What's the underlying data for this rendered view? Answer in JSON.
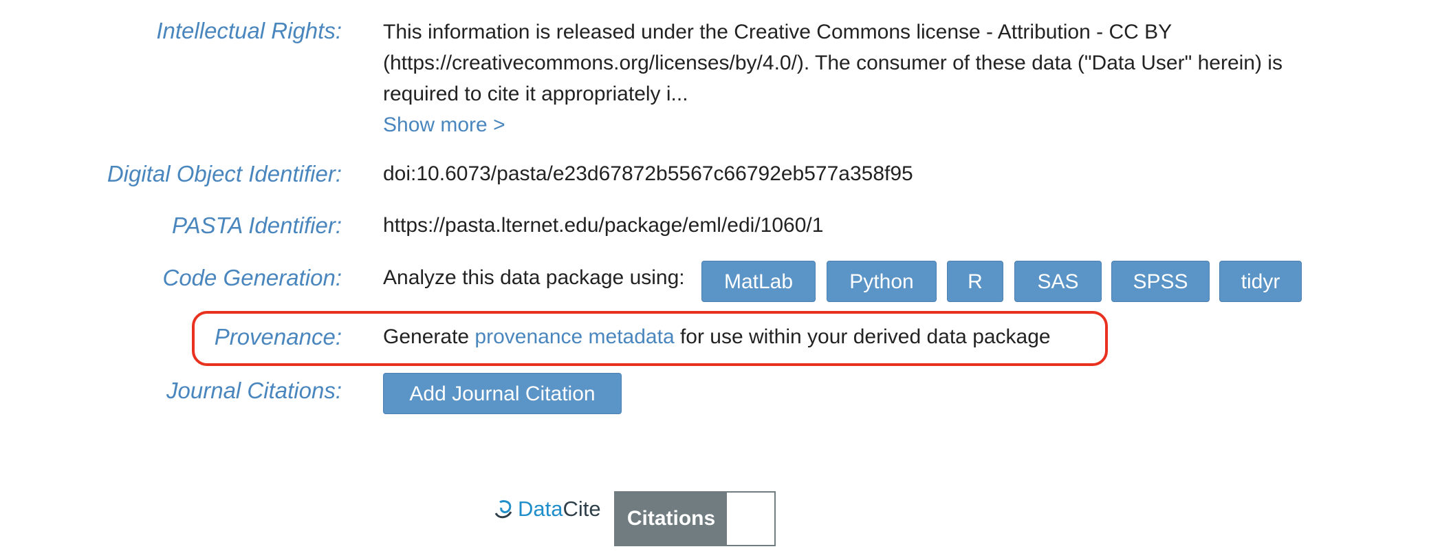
{
  "intellectual_rights": {
    "label": "Intellectual Rights:",
    "text": "This information is released under the Creative Commons license - Attribution - CC BY (https://creativecommons.org/licenses/by/4.0/). The consumer of these data (\"Data User\" herein) is required to cite it appropriately i...",
    "show_more": "Show more >"
  },
  "doi": {
    "label": "Digital Object Identifier:",
    "value": "doi:10.6073/pasta/e23d67872b5567c66792eb577a358f95"
  },
  "pasta": {
    "label": "PASTA Identifier:",
    "value": "https://pasta.lternet.edu/package/eml/edi/1060/1"
  },
  "code_generation": {
    "label": "Code Generation:",
    "intro": "Analyze this data package using:",
    "buttons": [
      "MatLab",
      "Python",
      "R",
      "SAS",
      "SPSS",
      "tidyr"
    ]
  },
  "provenance": {
    "label": "Provenance:",
    "prefix": "Generate ",
    "link": "provenance metadata",
    "suffix": " for use within your derived data package"
  },
  "journal_citations": {
    "label": "Journal Citations:",
    "button": "Add Journal Citation"
  },
  "datacite": {
    "brand_data": "Data",
    "brand_cite": "Cite",
    "citations_label": "Citations",
    "citations_count": ""
  },
  "colors": {
    "label_blue": "#4a86be",
    "button_blue": "#5b94c6",
    "highlight_red": "#e8321f",
    "datacite_blue": "#1f8ecb",
    "citations_gray": "#707c80"
  }
}
